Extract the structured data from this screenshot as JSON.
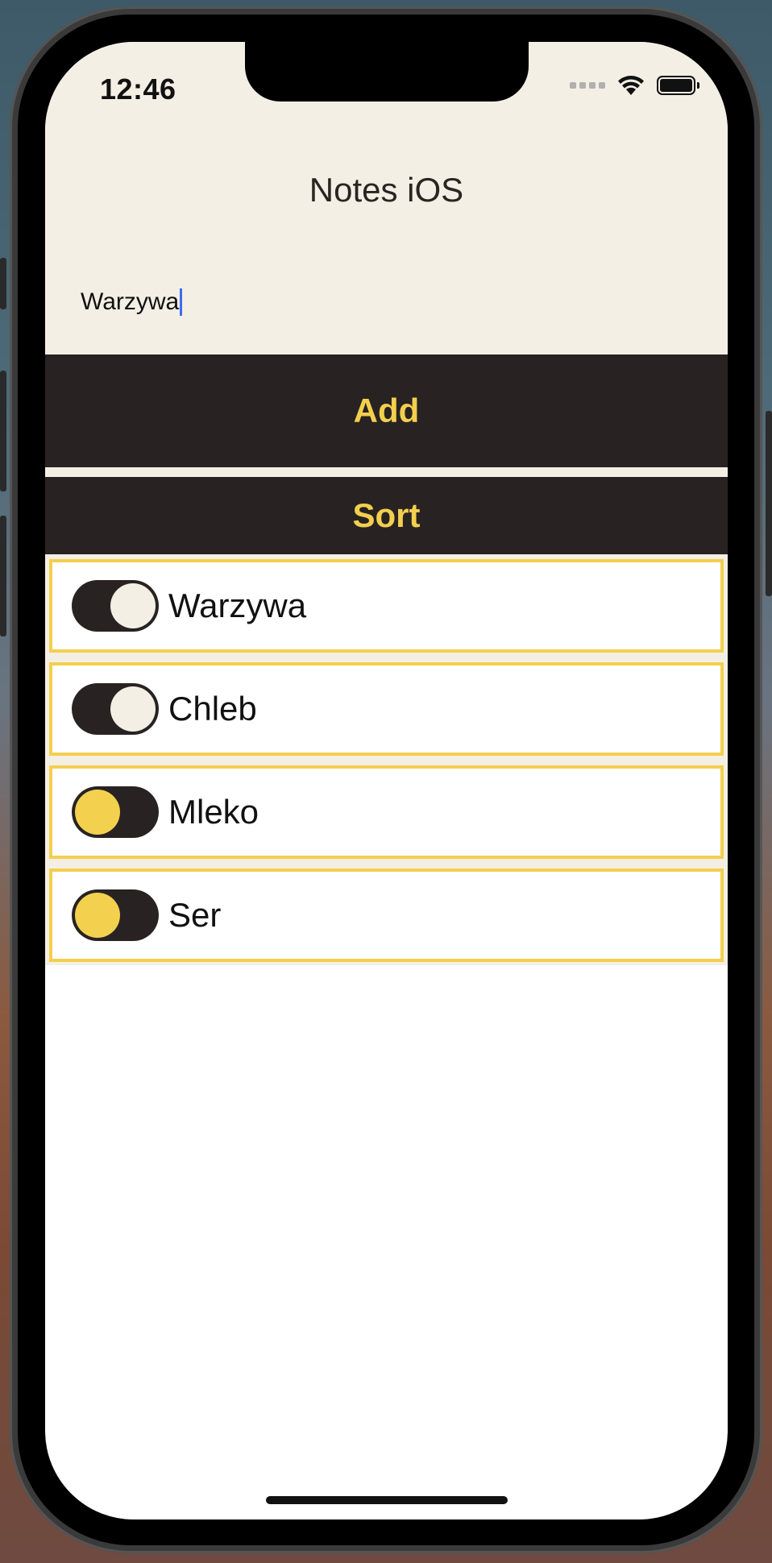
{
  "status_bar": {
    "time": "12:46"
  },
  "app": {
    "title": "Notes iOS"
  },
  "input": {
    "value": "Warzywa"
  },
  "buttons": {
    "add_label": "Add",
    "sort_label": "Sort"
  },
  "notes": [
    {
      "label": "Warzywa",
      "toggle_on": true
    },
    {
      "label": "Chleb",
      "toggle_on": true
    },
    {
      "label": "Mleko",
      "toggle_on": false
    },
    {
      "label": "Ser",
      "toggle_on": false
    }
  ],
  "colors": {
    "accent": "#f3cf4e",
    "dark": "#282322",
    "cream": "#f4efe5"
  }
}
